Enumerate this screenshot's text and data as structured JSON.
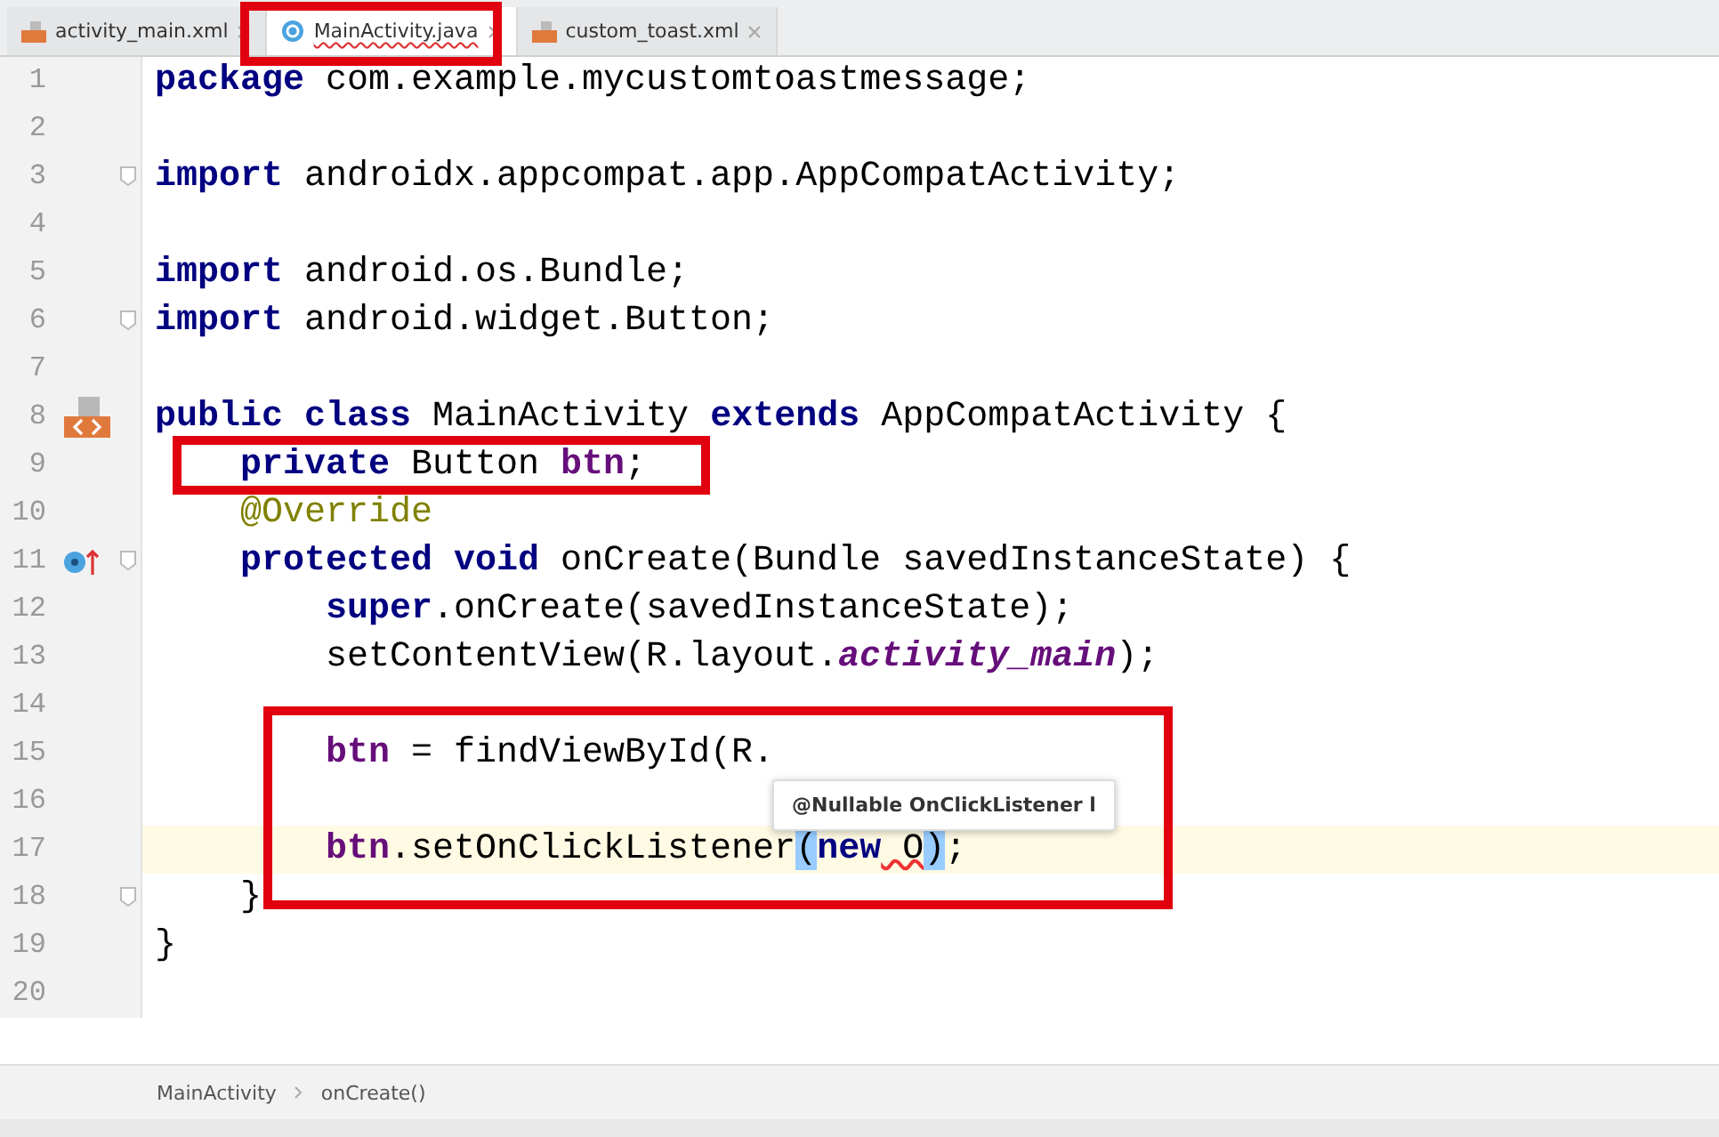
{
  "tabs": [
    {
      "label": "activity_main.xml",
      "kind": "xml",
      "selected": false
    },
    {
      "label": "MainActivity.java",
      "kind": "class",
      "selected": true
    },
    {
      "label": "custom_toast.xml",
      "kind": "xml",
      "selected": false
    }
  ],
  "lines": [
    {
      "number": "1",
      "fold": false,
      "tokens": [
        {
          "kind": "keyword",
          "text": "package"
        },
        {
          "kind": "plain",
          "text": " com.example.mycustomtoastmessage;"
        }
      ]
    },
    {
      "number": "2",
      "fold": false
    },
    {
      "number": "3",
      "fold": true,
      "tokens": [
        {
          "kind": "keyword",
          "text": "import"
        },
        {
          "kind": "plain",
          "text": " androidx.appcompat.app.AppCompatActivity;"
        }
      ]
    },
    {
      "number": "4",
      "fold": false
    },
    {
      "number": "5",
      "fold": false,
      "tokens": [
        {
          "kind": "keyword",
          "text": "import"
        },
        {
          "kind": "plain",
          "text": " android.os.Bundle;"
        }
      ]
    },
    {
      "number": "6",
      "fold": true,
      "tokens": [
        {
          "kind": "keyword",
          "text": "import"
        },
        {
          "kind": "plain",
          "text": " android.widget.Button;"
        }
      ]
    },
    {
      "number": "7",
      "fold": false
    },
    {
      "number": "8",
      "kind": "class",
      "fold": false,
      "tokens": [
        {
          "kind": "keyword",
          "text": "public class"
        },
        {
          "kind": "plain",
          "text": " MainActivity "
        },
        {
          "kind": "keyword",
          "text": "extends"
        },
        {
          "kind": "plain",
          "text": " AppCompatActivity {"
        }
      ],
      "children": [
        {
          "number": "9",
          "fold": false,
          "tokens": [
            {
              "kind": "keyword",
              "text": "private"
            },
            {
              "kind": "plain",
              "text": " Button "
            },
            {
              "kind": "field",
              "text": "btn"
            },
            {
              "kind": "plain",
              "text": ";"
            }
          ]
        },
        {
          "number": "10",
          "fold": false,
          "tokens": [
            {
              "kind": "annotation",
              "text": "@Override"
            }
          ]
        },
        {
          "number": "11",
          "kind": "override",
          "fold": true,
          "tokens": [
            {
              "kind": "keyword",
              "text": "protected void"
            },
            {
              "kind": "plain",
              "text": " onCreate(Bundle savedInstanceState) {"
            }
          ],
          "children": [
            {
              "number": "12",
              "fold": false,
              "tokens": [
                {
                  "kind": "keyword",
                  "text": "super"
                },
                {
                  "kind": "plain",
                  "text": ".onCreate(savedInstanceState);"
                }
              ]
            },
            {
              "number": "13",
              "fold": false,
              "tokens": [
                {
                  "kind": "plain",
                  "text": "setContentView(R.layout."
                },
                {
                  "kind": "static",
                  "text": "activity_main"
                },
                {
                  "kind": "plain",
                  "text": ");"
                }
              ]
            },
            {
              "number": "14",
              "fold": false
            },
            {
              "number": "15",
              "fold": false,
              "tokens": [
                {
                  "kind": "field",
                  "text": "btn"
                },
                {
                  "kind": "plain",
                  "text": " = findViewById(R."
                }
              ]
            },
            {
              "number": "16",
              "fold": false
            },
            {
              "number": "17",
              "fold": false,
              "current": true,
              "tokens": [
                {
                  "kind": "field",
                  "text": "btn"
                },
                {
                  "kind": "plain",
                  "text": ".setOnClickListener"
                },
                {
                  "kind": "match",
                  "text": "("
                },
                {
                  "kind": "keyword",
                  "text": "new"
                },
                {
                  "kind": "error",
                  "text": " O"
                },
                {
                  "kind": "match",
                  "text": ")"
                },
                {
                  "kind": "plain",
                  "text": ";"
                }
              ]
            }
          ]
        },
        {
          "number": "18",
          "fold": true,
          "tokens": [
            {
              "kind": "plain",
              "text": "}"
            }
          ]
        }
      ]
    },
    {
      "number": "19",
      "fold": false,
      "tokens": [
        {
          "kind": "plain",
          "text": "}"
        }
      ]
    },
    {
      "number": "20",
      "fold": false
    }
  ],
  "tooltip": "@Nullable OnClickListener l",
  "breadcrumbs": [
    "MainActivity",
    "onCreate()"
  ]
}
